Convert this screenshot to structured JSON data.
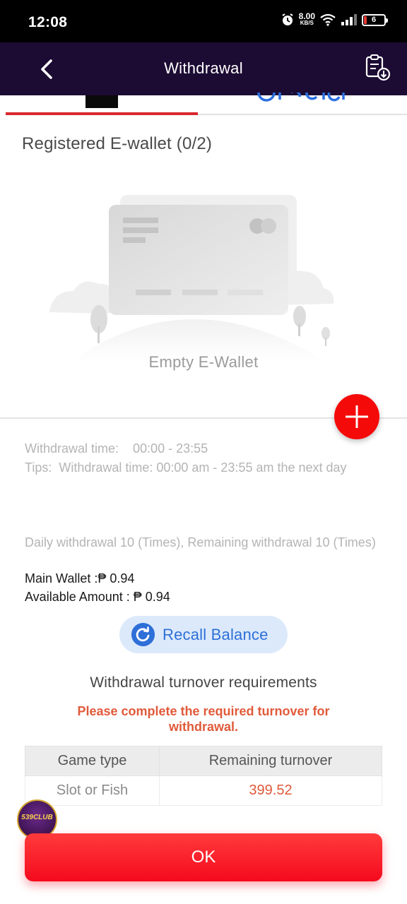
{
  "status_bar": {
    "time": "12:08",
    "net_speed_value": "8.00",
    "net_speed_unit": "KB/S",
    "battery": "6"
  },
  "header": {
    "title": "Withdrawal"
  },
  "section_title": "Registered E-wallet (0/2)",
  "empty_state": {
    "text": "Empty E-Wallet"
  },
  "info": {
    "withdrawal_time": "Withdrawal time:    00:00 - 23:55",
    "tips": "Tips:  Withdrawal time: 00:00 am - 23:55 am the next day",
    "daily": "Daily withdrawal 10 (Times), Remaining withdrawal 10 (Times)",
    "main_wallet": "Main Wallet :₱ 0.94",
    "available_amount": "Available Amount : ₱ 0.94"
  },
  "recall_button": {
    "label": "Recall Balance"
  },
  "turnover": {
    "title": "Withdrawal turnover requirements",
    "warning": "Please complete the required turnover for withdrawal.",
    "headers": [
      "Game type",
      "Remaining turnover"
    ],
    "rows": [
      {
        "game_type": "Slot or Fish",
        "remaining": "399.52"
      }
    ]
  },
  "badge_text": "539CLUB",
  "ok_button": {
    "label": "OK"
  },
  "colors": {
    "header_bg": "#1c0b33",
    "accent_red": "#f50a0a",
    "active_tab": "#d9272e",
    "recall_blue": "#2e6fd8",
    "warn_orange": "#e05a3a"
  }
}
